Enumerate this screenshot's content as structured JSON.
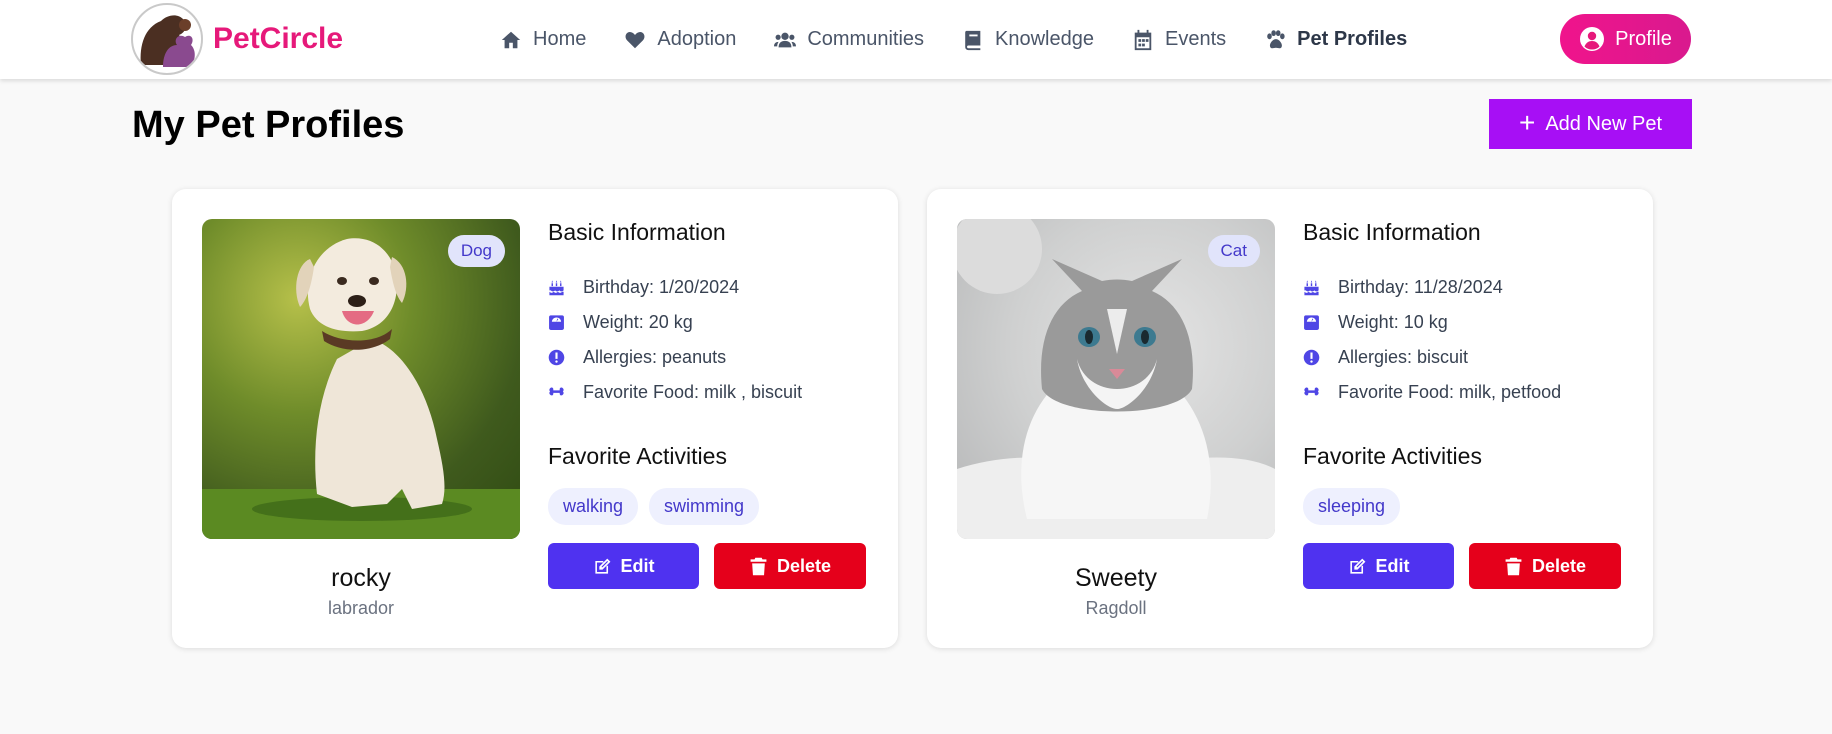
{
  "app": {
    "name": "PetCircle"
  },
  "nav": {
    "items": [
      {
        "label": "Home",
        "icon": "home-icon"
      },
      {
        "label": "Adoption",
        "icon": "heart-icon"
      },
      {
        "label": "Communities",
        "icon": "users-icon"
      },
      {
        "label": "Knowledge",
        "icon": "book-icon"
      },
      {
        "label": "Events",
        "icon": "calendar-icon"
      },
      {
        "label": "Pet Profiles",
        "icon": "paw-icon",
        "active": true
      }
    ],
    "profile_label": "Profile"
  },
  "page": {
    "title": "My Pet Profiles",
    "add_label": "Add New Pet"
  },
  "pets": [
    {
      "name": "rocky",
      "breed": "labrador",
      "species": "Dog",
      "basic_title": "Basic Information",
      "birthday": "Birthday: 1/20/2024",
      "weight": "Weight: 20 kg",
      "allergies": "Allergies: peanuts",
      "food": "Favorite Food: milk , biscuit",
      "activities_title": "Favorite Activities",
      "activities": [
        "walking",
        "swimming"
      ],
      "edit_label": "Edit",
      "delete_label": "Delete"
    },
    {
      "name": "Sweety",
      "breed": "Ragdoll",
      "species": "Cat",
      "basic_title": "Basic Information",
      "birthday": "Birthday: 11/28/2024",
      "weight": "Weight: 10 kg",
      "allergies": "Allergies: biscuit",
      "food": "Favorite Food: milk, petfood",
      "activities_title": "Favorite Activities",
      "activities": [
        "sleeping"
      ],
      "edit_label": "Edit",
      "delete_label": "Delete"
    }
  ],
  "colors": {
    "brand": "#e6197a",
    "primary": "#4f32f0",
    "danger": "#e5001b",
    "add": "#a70ff5"
  }
}
